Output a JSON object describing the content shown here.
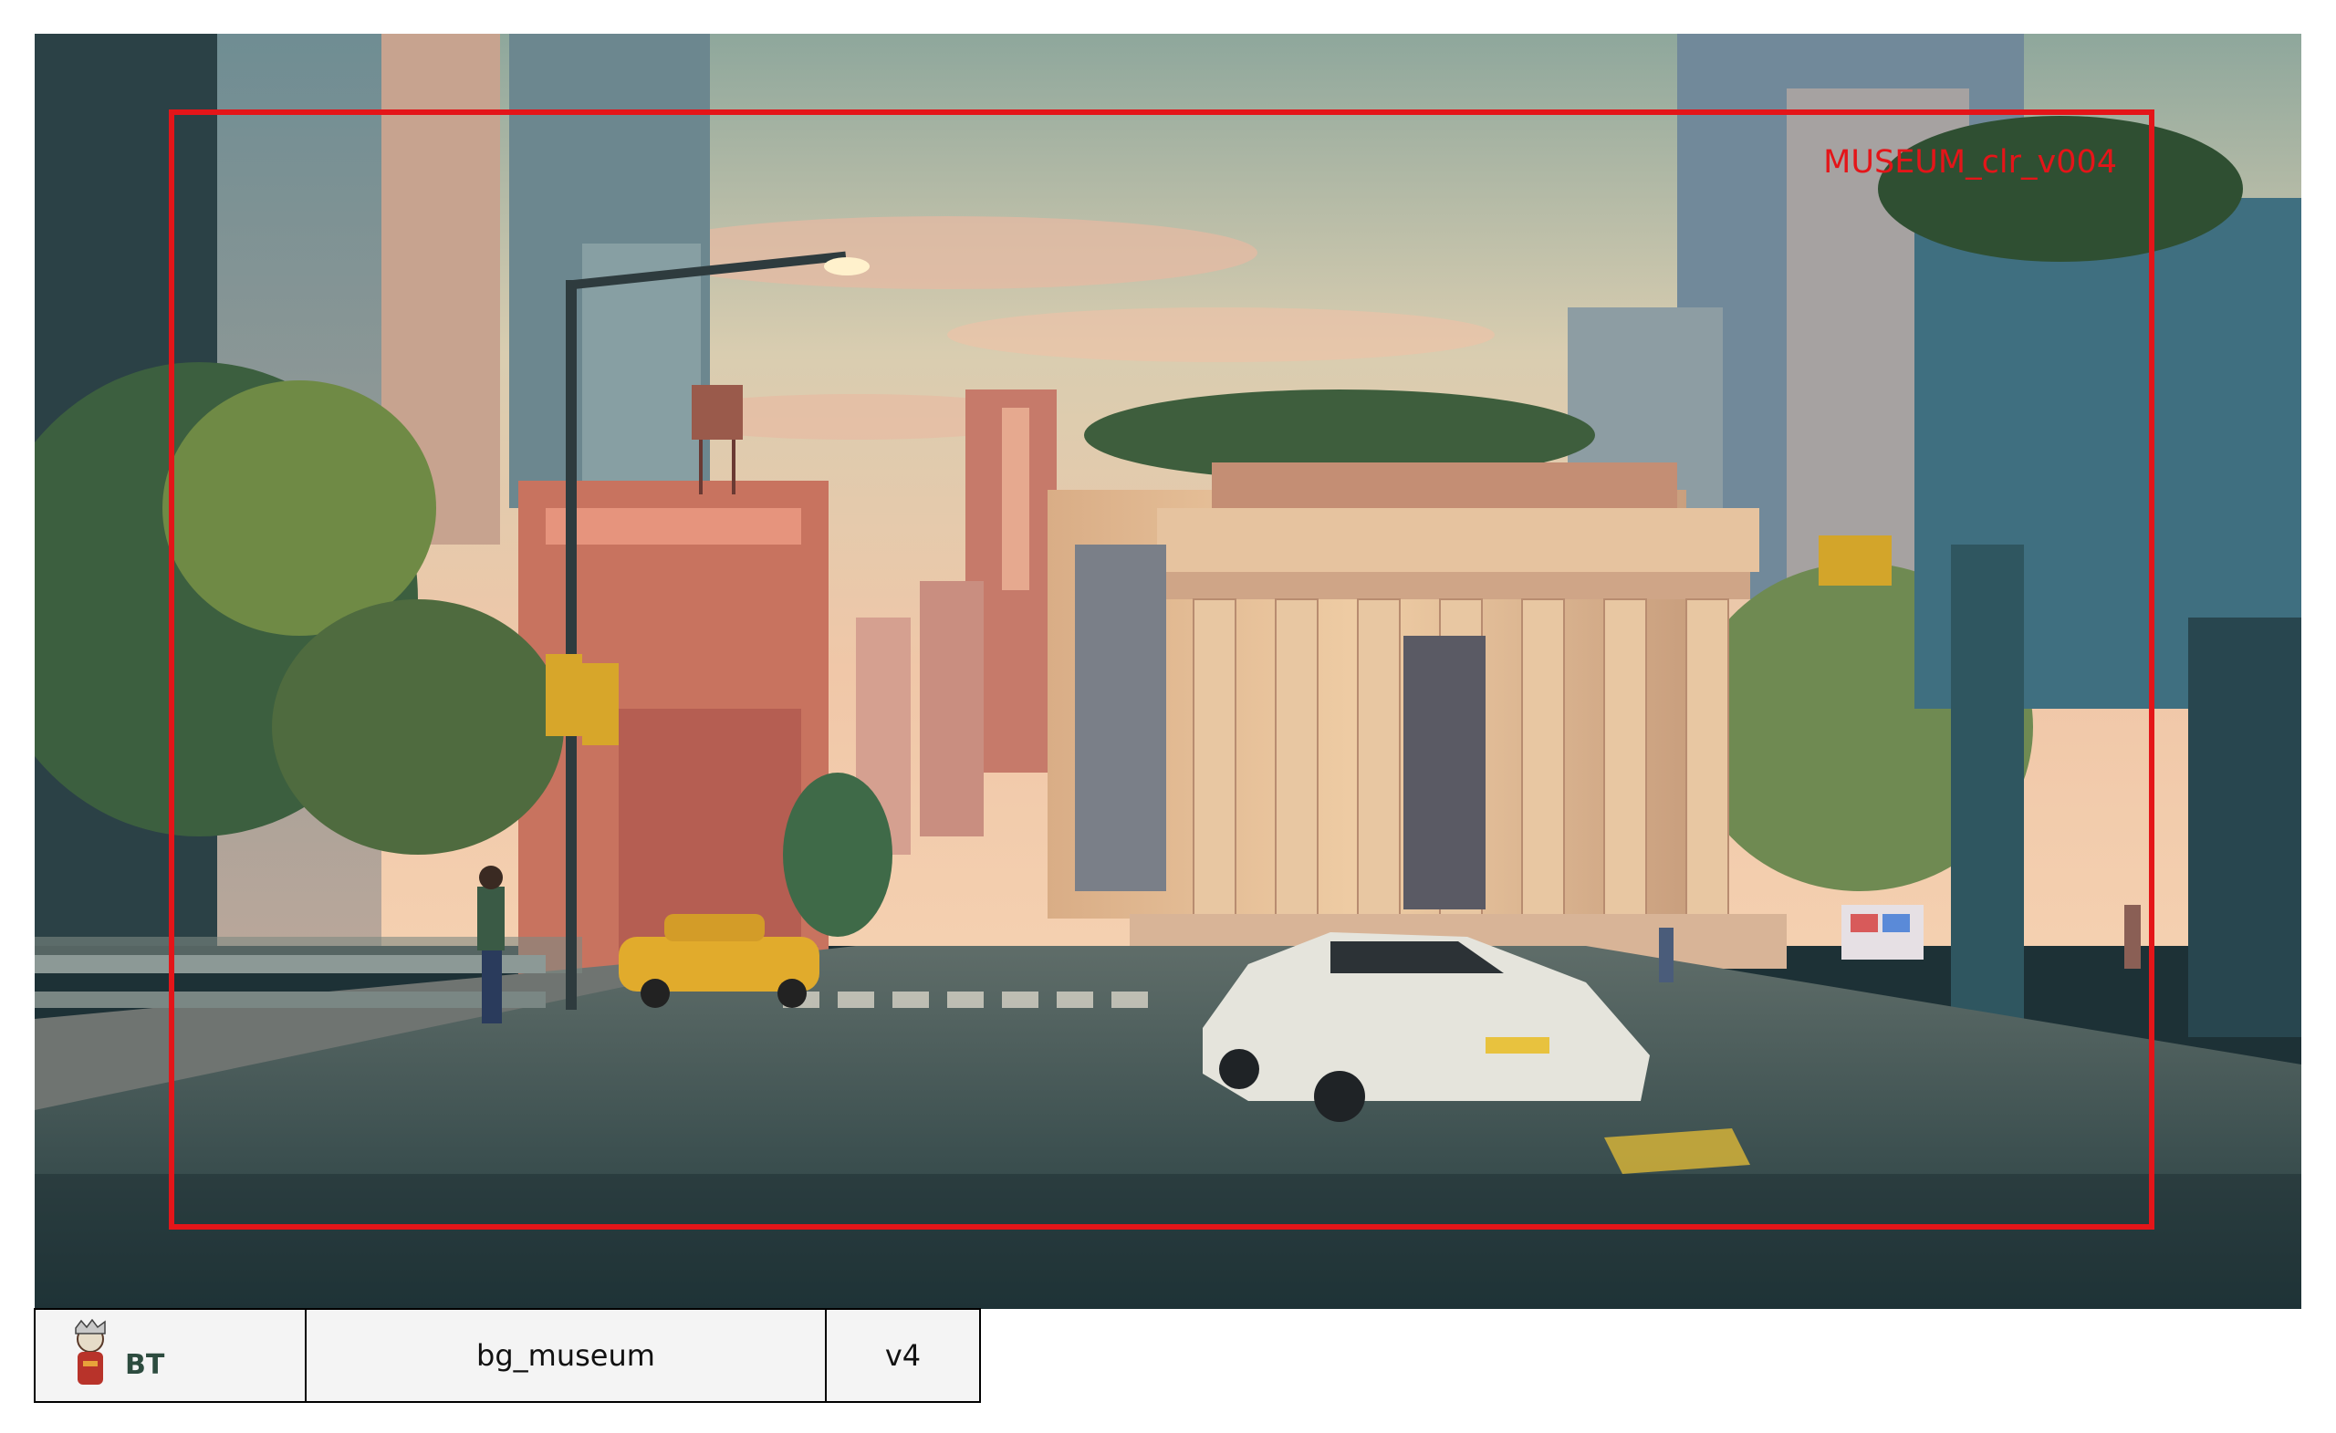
{
  "frame_label": "MUSEUM_clr_v004",
  "slate": {
    "logo_text": "BT",
    "name": "bg_museum",
    "version": "v4"
  },
  "colors": {
    "safe_frame": "#e41519",
    "sky": "#c9d2b4",
    "museum_stone": "#e2bf98",
    "taxi": "#e7b12a",
    "road": "#2f4a4e"
  }
}
